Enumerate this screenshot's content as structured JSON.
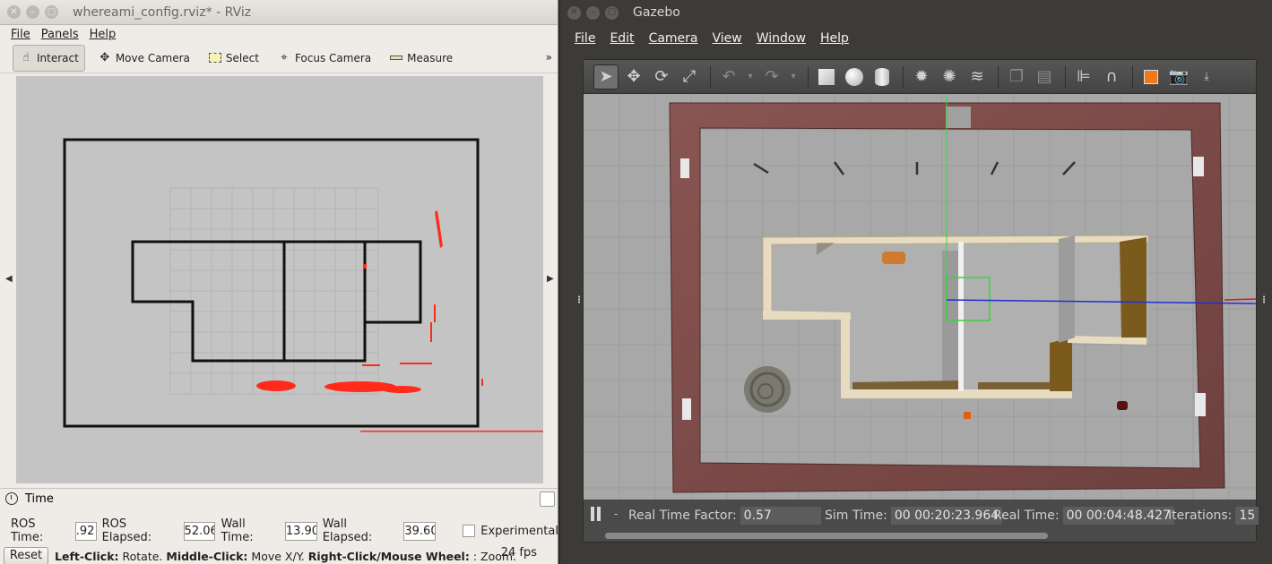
{
  "rviz": {
    "title": "whereami_config.rviz* - RViz",
    "menu": [
      "File",
      "Panels",
      "Help"
    ],
    "tools": [
      {
        "label": "Interact",
        "icon": "hand-pointer-icon"
      },
      {
        "label": "Move Camera",
        "icon": "move-camera-icon"
      },
      {
        "label": "Select",
        "icon": "select-box-icon"
      },
      {
        "label": "Focus Camera",
        "icon": "focus-camera-icon"
      },
      {
        "label": "Measure",
        "icon": "ruler-icon"
      }
    ],
    "overflow": "»",
    "time_panel": {
      "title": "Time",
      "ros_time_label": "ROS Time:",
      "ros_time": ".92",
      "ros_elapsed_label": "ROS Elapsed:",
      "ros_elapsed": "52.06",
      "wall_time_label": "Wall Time:",
      "wall_time": "13.90",
      "wall_elapsed_label": "Wall Elapsed:",
      "wall_elapsed": "39.60",
      "experimental_label": "Experimental"
    },
    "status": {
      "reset_label": "Reset",
      "hint_left_key": "Left-Click:",
      "hint_left_val": "Rotate.",
      "hint_mid_key": "Middle-Click:",
      "hint_mid_val": "Move X/Y.",
      "hint_right_key": "Right-Click/Mouse Wheel:",
      "hint_right_val": ": Zoom.",
      "fps": "24 fps"
    }
  },
  "gazebo": {
    "title": "Gazebo",
    "menu": [
      "File",
      "Edit",
      "Camera",
      "View",
      "Window",
      "Help"
    ],
    "status": {
      "rtf_label": "Real Time Factor:",
      "rtf": "0.57",
      "sim_time_label": "Sim Time:",
      "sim_time": "00 00:20:23.964",
      "real_time_label": "Real Time:",
      "real_time": "00 00:04:48.427",
      "iterations_label": "Iterations:",
      "iterations": "15"
    }
  },
  "colors": {
    "laser": "#ff2a1a",
    "rviz_bg": "#efebe7",
    "gazebo_bg": "#3c3b37",
    "brick": "#7a4a48",
    "floor": "#a8a8a8"
  }
}
